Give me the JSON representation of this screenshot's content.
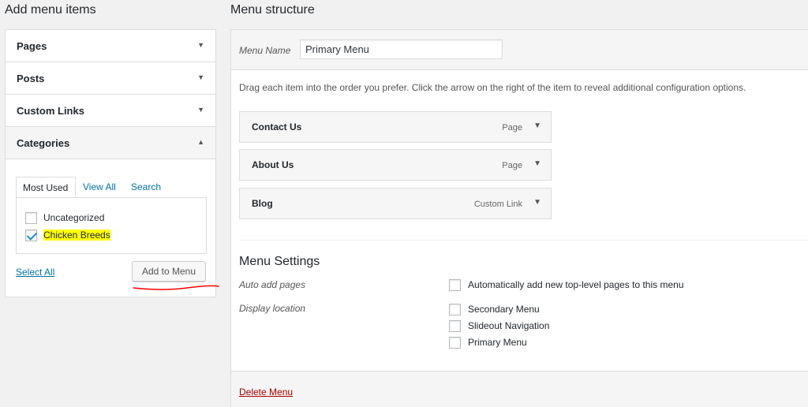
{
  "left": {
    "title": "Add menu items",
    "accordion": [
      {
        "label": "Pages",
        "arrow": "▼"
      },
      {
        "label": "Posts",
        "arrow": "▼"
      },
      {
        "label": "Custom Links",
        "arrow": "▼"
      },
      {
        "label": "Categories",
        "arrow": "▲"
      }
    ],
    "categories": {
      "tabs": {
        "most_used": "Most Used",
        "view_all": "View All",
        "search": "Search"
      },
      "items": [
        {
          "label": "Uncategorized",
          "checked": false
        },
        {
          "label": "Chicken Breeds",
          "checked": true
        }
      ],
      "select_all": "Select All",
      "add_button": "Add to Menu"
    }
  },
  "right": {
    "title": "Menu structure",
    "menu_name_label": "Menu Name",
    "menu_name_value": "Primary Menu",
    "instructions": "Drag each item into the order you prefer. Click the arrow on the right of the item to reveal additional configuration options.",
    "items": [
      {
        "title": "Contact Us",
        "type": "Page",
        "toggle": "▼"
      },
      {
        "title": "About Us",
        "type": "Page",
        "toggle": "▼"
      },
      {
        "title": "Blog",
        "type": "Custom Link",
        "toggle": "▼"
      }
    ],
    "settings": {
      "title": "Menu Settings",
      "auto_add_label": "Auto add pages",
      "auto_add_option": "Automatically add new top-level pages to this menu",
      "display_location_label": "Display location",
      "locations": [
        "Secondary Menu",
        "Slideout Navigation",
        "Primary Menu"
      ]
    },
    "delete_menu": "Delete Menu"
  },
  "colors": {
    "link": "#0073aa",
    "delete": "#aa0000",
    "highlight": "#ffff00",
    "annotation": "#ff0000"
  }
}
